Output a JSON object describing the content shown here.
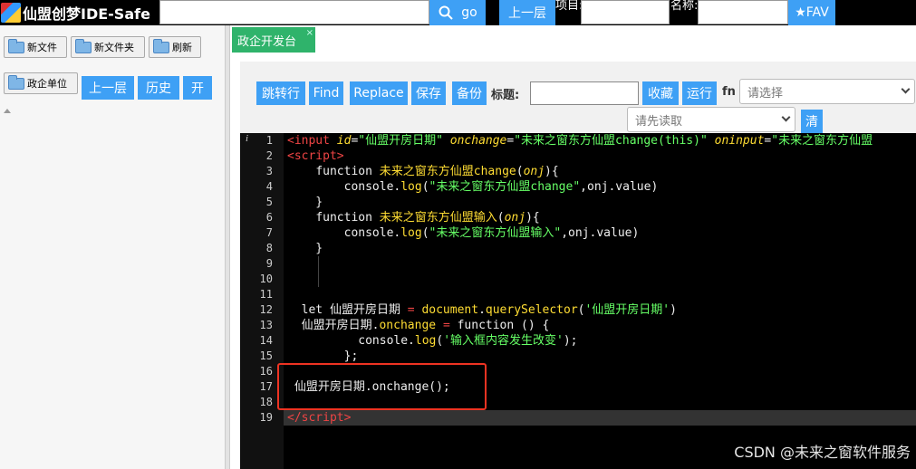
{
  "app": {
    "title": "仙盟创梦IDE-Safe",
    "go_label": "go",
    "up_label": "上一层",
    "project_label": "项目:",
    "name_label": "名称:",
    "fav_label": "★FAV",
    "colors": {
      "blue": "#3ea0f5",
      "green_tab": "#2fb36b",
      "topbar": "#000000"
    }
  },
  "sidebar": {
    "buttons": {
      "new_file": "新文件",
      "new_folder": "新文件夹",
      "refresh": "刷新",
      "unit": "政企单位",
      "up": "上一层",
      "history": "历史",
      "open": "开"
    }
  },
  "tabs": [
    {
      "label": "政企开发台",
      "close": "×"
    }
  ],
  "toolbar": {
    "goto": "跳转行",
    "find": "Find",
    "replace": "Replace",
    "save": "保存",
    "backup": "备份",
    "title_label": "标题:",
    "collect": "收藏",
    "run": "运行",
    "fn_label": "fn",
    "select_placeholder": "请选择",
    "read_placeholder": "请先读取",
    "clear": "清"
  },
  "editor": {
    "line_numbers": [
      "1",
      "2",
      "3",
      "4",
      "5",
      "6",
      "7",
      "8",
      "9",
      "10",
      "11",
      "12",
      "13",
      "14",
      "15",
      "16",
      "17",
      "18",
      "19"
    ],
    "active_line": 19
  },
  "watermark": "CSDN @未来之窗软件服务"
}
